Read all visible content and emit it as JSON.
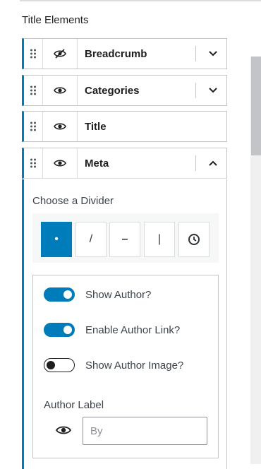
{
  "section": {
    "title": "Title Elements"
  },
  "elements": [
    {
      "label": "Breadcrumb",
      "visible": false,
      "chevron": "chevron-down"
    },
    {
      "label": "Categories",
      "visible": true,
      "chevron": "chevron-down"
    },
    {
      "label": "Title",
      "visible": true,
      "chevron": ""
    },
    {
      "label": "Meta",
      "visible": true,
      "chevron": "chevron-up"
    }
  ],
  "meta_panel": {
    "divider_label": "Choose a Divider",
    "dividers": [
      {
        "symbol": "•",
        "icon": "dot-icon",
        "selected": true
      },
      {
        "symbol": "/",
        "icon": "slash-icon",
        "selected": false
      },
      {
        "symbol": "–",
        "icon": "dash-icon",
        "selected": false
      },
      {
        "symbol": "|",
        "icon": "vline-icon",
        "selected": false
      },
      {
        "symbol": "",
        "icon": "clock-icon",
        "selected": false
      }
    ],
    "toggles": [
      {
        "label": "Show Author?",
        "on": true
      },
      {
        "label": "Enable Author Link?",
        "on": true
      },
      {
        "label": "Show Author Image?",
        "on": false
      }
    ],
    "author_label": {
      "label": "Author Label",
      "placeholder": "By",
      "value": ""
    }
  },
  "colors": {
    "accent": "#007cba",
    "border": "#c3c4c7"
  }
}
